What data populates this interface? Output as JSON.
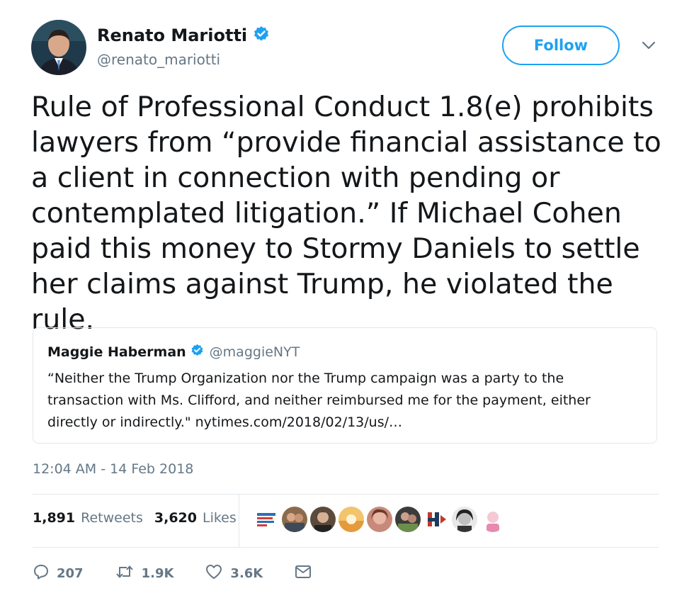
{
  "author": {
    "name": "Renato Mariotti",
    "handle": "@renato_mariotti",
    "verified": true
  },
  "follow_button": {
    "label": "Follow"
  },
  "tweet": {
    "text": "Rule of Professional Conduct 1.8(e) prohibits lawyers from “provide financial assistance to a client in connection with pending or contemplated litigation.” If Michael Cohen paid this money to Stormy Daniels to settle her claims against Trump, he violated the rule."
  },
  "quoted_tweet": {
    "name": "Maggie Haberman",
    "handle": "@maggieNYT",
    "verified": true,
    "text": "“Neither the Trump Organization nor the Trump campaign was a party to the transaction with Ms. Clifford, and neither reimbursed me for the payment, either directly or indirectly.\" nytimes.com/2018/02/13/us/…"
  },
  "timestamp": "12:04 AM - 14 Feb 2018",
  "stats": {
    "retweets_count": "1,891",
    "retweets_label": "Retweets",
    "likes_count": "3,620",
    "likes_label": "Likes"
  },
  "liker_avatars": [
    "avatar-1",
    "avatar-2",
    "avatar-3",
    "avatar-4",
    "avatar-5",
    "avatar-6",
    "avatar-7",
    "avatar-8",
    "avatar-9"
  ],
  "actions": {
    "replies": "207",
    "retweets": "1.9K",
    "likes": "3.6K"
  },
  "colors": {
    "accent": "#1da1f2",
    "text": "#14171a",
    "secondary": "#657786",
    "border": "#e1e8ed"
  }
}
